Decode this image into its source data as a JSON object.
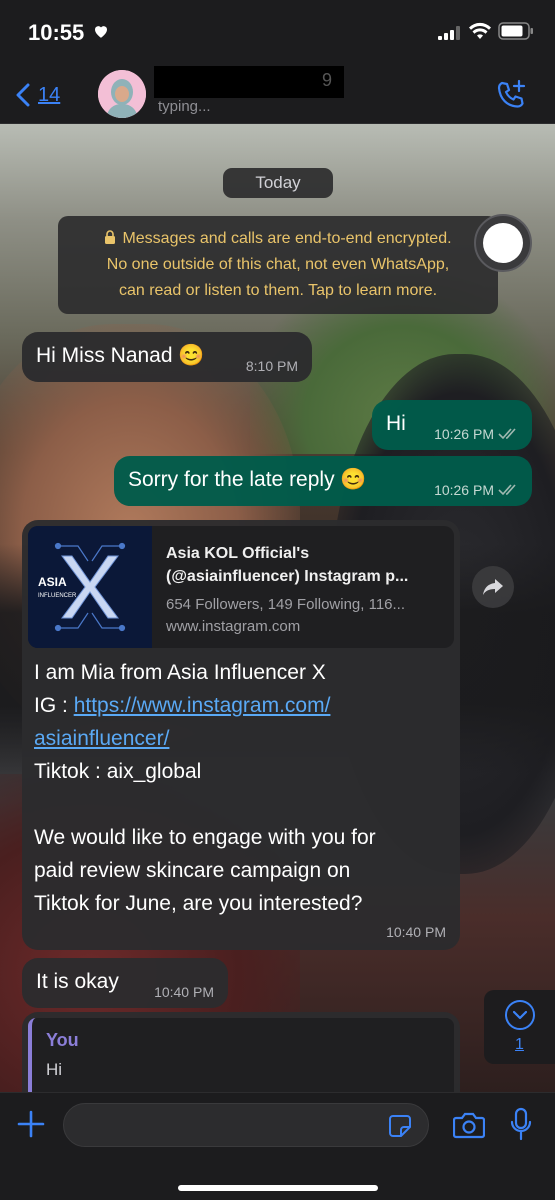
{
  "status_bar": {
    "time": "10:55"
  },
  "header": {
    "back_count": "14",
    "contact_name_visible_digit": "9",
    "status": "typing..."
  },
  "chat": {
    "date_label": "Today",
    "encryption_notice": [
      "Messages and calls are end-to-end encrypted.",
      "No one outside of this chat, not even WhatsApp,",
      "can read or listen to them. Tap to learn more."
    ],
    "messages": [
      {
        "direction": "in",
        "text": "Hi Miss Nanad 😊",
        "time": "8:10 PM"
      },
      {
        "direction": "out",
        "text": "Hi",
        "time": "10:26 PM"
      },
      {
        "direction": "out",
        "text": "Sorry for the late reply 😊",
        "time": "10:26 PM"
      },
      {
        "direction": "in",
        "link_preview": {
          "thumb_text": [
            "ASIA",
            "INFLUENCER"
          ],
          "title_lines": [
            "Asia KOL Official's",
            "(@asiainfluencer) Instagram p..."
          ],
          "description": "654 Followers, 149 Following, 116...",
          "url": "www.instagram.com"
        },
        "lines": {
          "l1": "I am Mia from Asia Influencer X",
          "l2_prefix": "IG : ",
          "l2_link": "https://www.instagram.com/",
          "l3_link": "asiainfluencer/",
          "l4": "Tiktok : aix_global",
          "l5": "We would like to engage with you for",
          "l6": "paid review skincare campaign on",
          "l7": "Tiktok for June, are you interested?"
        },
        "time": "10:40 PM"
      },
      {
        "direction": "in",
        "text": "It is okay",
        "time": "10:40 PM"
      },
      {
        "direction": "in",
        "quote": {
          "author": "You",
          "text": "Hi"
        }
      }
    ],
    "unread_count": "1"
  },
  "input": {
    "placeholder": ""
  },
  "colors": {
    "accent": "#3b82f6",
    "incoming_bubble": "#2c2c2e",
    "outgoing_bubble": "#005c4b",
    "encryption_text": "#e9c46a",
    "quote_author": "#8b7ed8",
    "link": "#5aa9f5"
  }
}
